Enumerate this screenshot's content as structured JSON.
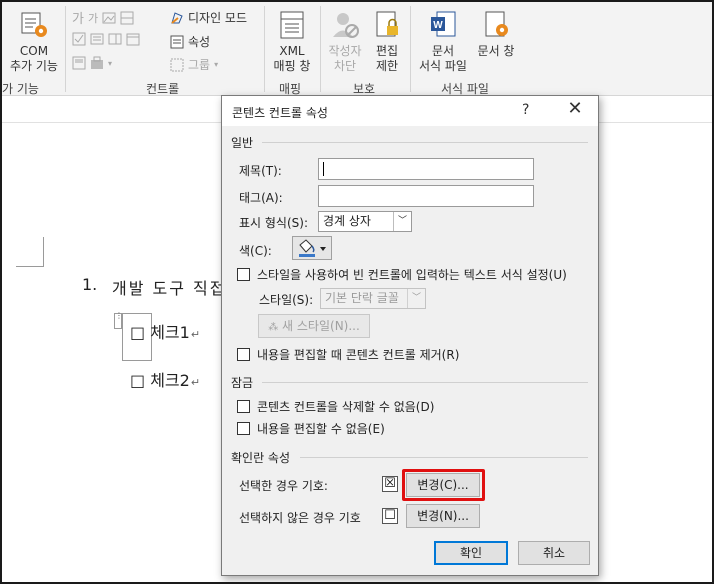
{
  "ribbon": {
    "com_addin": {
      "line1": "COM",
      "line2": "추가 기능"
    },
    "addin_group_label": "가 기능",
    "controls": {
      "aa1": "가",
      "aa2": "가",
      "design_mode": "디자인 모드",
      "properties": "속성",
      "group": "그룹",
      "group_label": "컨트롤"
    },
    "mapping": {
      "line1": "XML",
      "line2": "매핑 창",
      "group_label": "매핑"
    },
    "protect": {
      "author_line1": "작성자",
      "author_line2": "차단",
      "edit_line1": "편집",
      "edit_line2": "제한",
      "group_label": "보호"
    },
    "template": {
      "doc_line1": "문서",
      "doc_line2": "서식 파일",
      "pane_line1": "문서 창",
      "group_label": "서식 파일"
    }
  },
  "document": {
    "list_number": "1.",
    "list_text": "개발 도구 직접",
    "check1": "□ 체크1",
    "check2": "□ 체크2",
    "pilcrow": "↵"
  },
  "dialog": {
    "title": "콘텐츠 컨트롤 속성",
    "help": "?",
    "close": "✕",
    "general": {
      "heading": "일반",
      "title_label": "제목(T):",
      "title_value": "",
      "tag_label": "태그(A):",
      "tag_value": "",
      "display_label": "표시 형식(S):",
      "display_value": "경계 상자",
      "color_label": "색(C):",
      "use_style_label": "스타일을 사용하여 빈 컨트롤에 입력하는 텍스트 서식 설정(U)",
      "style_label": "스타일(S):",
      "style_value": "기본 단락 글꼴",
      "new_style_button": "새 스타일(N)...",
      "remove_on_edit_label": "내용을 편집할 때 콘텐츠 컨트롤 제거(R)"
    },
    "locking": {
      "heading": "잠금",
      "no_delete_label": "콘텐츠 컨트롤을 삭제할 수 없음(D)",
      "no_edit_label": "내용을 편집할 수 없음(E)"
    },
    "checkbox_props": {
      "heading": "확인란 속성",
      "checked_label": "선택한 경우 기호:",
      "checked_symbol": "☒",
      "checked_change_button": "변경(C)...",
      "unchecked_label": "선택하지 않은 경우 기호",
      "unchecked_symbol": "☐",
      "unchecked_change_button": "변경(N)..."
    },
    "ok_button": "확인",
    "cancel_button": "취소"
  },
  "colors": {
    "highlight": "#e01010",
    "primary_border": "#0078d7",
    "word_blue": "#2b579a",
    "accent_orange": "#e8891e"
  }
}
